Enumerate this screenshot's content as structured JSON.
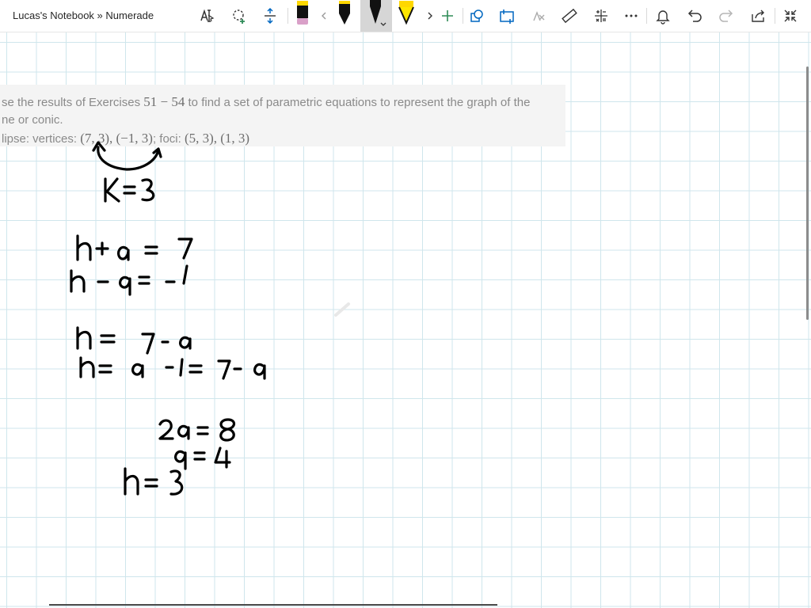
{
  "window": {
    "title": "Lucas's Notebook » Numerade"
  },
  "toolbar": {
    "tools": [
      {
        "name": "text-select-icon"
      },
      {
        "name": "lasso-select-icon"
      },
      {
        "name": "add-space-icon"
      },
      {
        "name": "pink-highlighter-icon"
      },
      {
        "name": "scroll-left-icon"
      },
      {
        "name": "black-pen-icon"
      },
      {
        "name": "black-marker-icon"
      },
      {
        "name": "yellow-highlighter-icon"
      },
      {
        "name": "scroll-right-icon"
      },
      {
        "name": "add-pen-icon"
      },
      {
        "name": "ink-to-shape-icon"
      },
      {
        "name": "ink-to-text-icon"
      },
      {
        "name": "ink-to-math-icon"
      },
      {
        "name": "ruler-icon"
      },
      {
        "name": "math-icon"
      },
      {
        "name": "more-icon"
      },
      {
        "name": "bell-icon"
      },
      {
        "name": "undo-icon"
      },
      {
        "name": "redo-icon"
      },
      {
        "name": "share-icon"
      },
      {
        "name": "fullscreen-icon"
      }
    ]
  },
  "problem": {
    "line1_pre": "se the results of Exercises ",
    "line1_math": "51 − 54",
    "line1_post": " to find a set of parametric equations to represent the graph of the",
    "line2": "ne or conic.",
    "line3_pre": "lipse: vertices: ",
    "line3_math1": "(7, 3), (−1, 3)",
    "line3_mid": "; foci: ",
    "line3_math2": "(5, 3), (1, 3)"
  },
  "colors": {
    "grid": "#cfe6ec",
    "ink": "#000000",
    "problem_bg": "#f4f4f4"
  }
}
